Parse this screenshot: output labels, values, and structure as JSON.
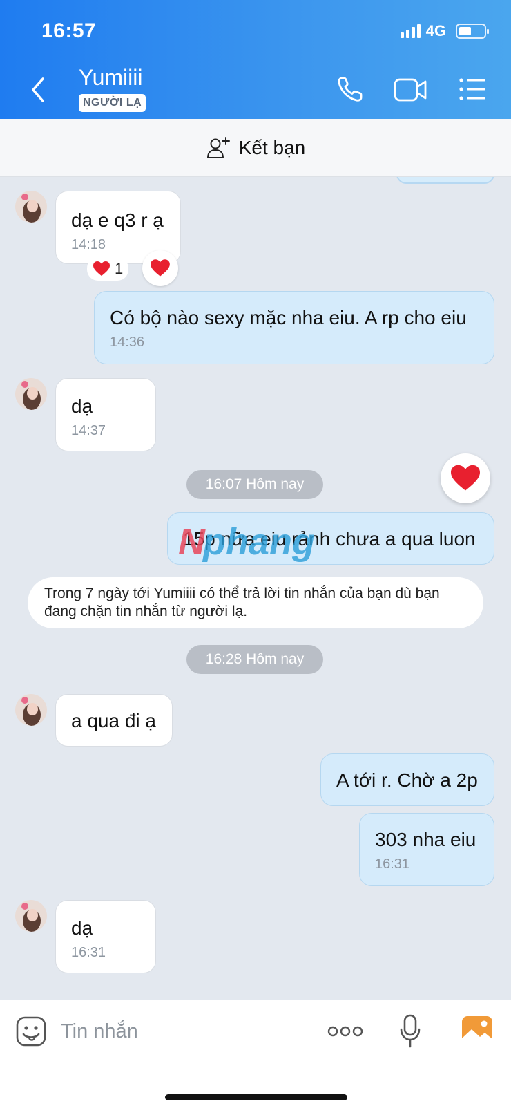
{
  "status_bar": {
    "time": "16:57",
    "network": "4G"
  },
  "header": {
    "contact_name": "Yumiiii",
    "stranger_badge": "NGƯỜI LẠ"
  },
  "friend_bar": {
    "label": "Kết bạn"
  },
  "messages": [
    {
      "direction": "incoming",
      "text": "dạ e q3 r ạ",
      "time": "14:18",
      "reaction_count": "1"
    },
    {
      "direction": "outgoing",
      "text": "Có bộ nào sexy mặc nha eiu. A rp cho eiu",
      "time": "14:36"
    },
    {
      "direction": "incoming",
      "text": "dạ",
      "time": "14:37"
    },
    {
      "direction": "outgoing",
      "text": "15p nữa eiu rảnh chưa a qua luon"
    },
    {
      "direction": "incoming",
      "text": "a qua đi ạ"
    },
    {
      "direction": "outgoing",
      "text": "A tới r. Chờ a 2p"
    },
    {
      "direction": "outgoing",
      "text": "303 nha eiu",
      "time": "16:31"
    },
    {
      "direction": "incoming",
      "text": "dạ",
      "time": "16:31"
    }
  ],
  "dividers": [
    "16:07 Hôm nay",
    "16:28 Hôm nay"
  ],
  "notice": "Trong 7 ngày tới Yumiiii có thể trả lời tin nhắn của bạn dù bạn đang chặn tin nhắn từ người lạ.",
  "watermark": "Nphang",
  "input": {
    "placeholder": "Tin nhắn"
  },
  "icons": [
    "back-icon",
    "phone-icon",
    "video-call-icon",
    "menu-list-icon",
    "add-friend-icon",
    "heart-icon",
    "sticker-icon",
    "more-icon",
    "microphone-icon",
    "image-icon"
  ],
  "colors": {
    "header_start": "#1f7cf0",
    "header_end": "#4aa6ee",
    "outgoing_bubble": "#d5ebfb",
    "incoming_bubble": "#ffffff",
    "heart": "#e8202f",
    "chat_bg": "#e3e8ef"
  }
}
